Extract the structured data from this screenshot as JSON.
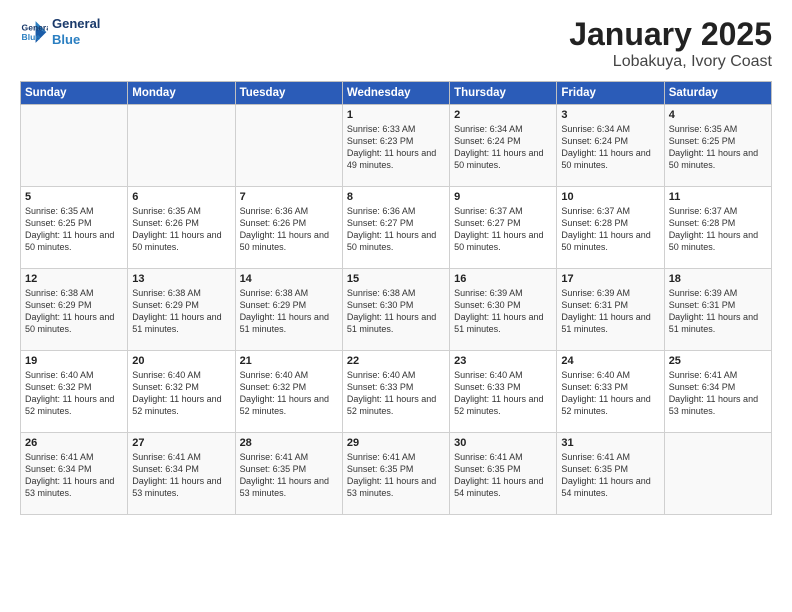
{
  "logo": {
    "line1": "General",
    "line2": "Blue"
  },
  "title": "January 2025",
  "subtitle": "Lobakuya, Ivory Coast",
  "days_of_week": [
    "Sunday",
    "Monday",
    "Tuesday",
    "Wednesday",
    "Thursday",
    "Friday",
    "Saturday"
  ],
  "weeks": [
    [
      {
        "day": "",
        "info": ""
      },
      {
        "day": "",
        "info": ""
      },
      {
        "day": "",
        "info": ""
      },
      {
        "day": "1",
        "info": "Sunrise: 6:33 AM\nSunset: 6:23 PM\nDaylight: 11 hours and 49 minutes."
      },
      {
        "day": "2",
        "info": "Sunrise: 6:34 AM\nSunset: 6:24 PM\nDaylight: 11 hours and 50 minutes."
      },
      {
        "day": "3",
        "info": "Sunrise: 6:34 AM\nSunset: 6:24 PM\nDaylight: 11 hours and 50 minutes."
      },
      {
        "day": "4",
        "info": "Sunrise: 6:35 AM\nSunset: 6:25 PM\nDaylight: 11 hours and 50 minutes."
      }
    ],
    [
      {
        "day": "5",
        "info": "Sunrise: 6:35 AM\nSunset: 6:25 PM\nDaylight: 11 hours and 50 minutes."
      },
      {
        "day": "6",
        "info": "Sunrise: 6:35 AM\nSunset: 6:26 PM\nDaylight: 11 hours and 50 minutes."
      },
      {
        "day": "7",
        "info": "Sunrise: 6:36 AM\nSunset: 6:26 PM\nDaylight: 11 hours and 50 minutes."
      },
      {
        "day": "8",
        "info": "Sunrise: 6:36 AM\nSunset: 6:27 PM\nDaylight: 11 hours and 50 minutes."
      },
      {
        "day": "9",
        "info": "Sunrise: 6:37 AM\nSunset: 6:27 PM\nDaylight: 11 hours and 50 minutes."
      },
      {
        "day": "10",
        "info": "Sunrise: 6:37 AM\nSunset: 6:28 PM\nDaylight: 11 hours and 50 minutes."
      },
      {
        "day": "11",
        "info": "Sunrise: 6:37 AM\nSunset: 6:28 PM\nDaylight: 11 hours and 50 minutes."
      }
    ],
    [
      {
        "day": "12",
        "info": "Sunrise: 6:38 AM\nSunset: 6:29 PM\nDaylight: 11 hours and 50 minutes."
      },
      {
        "day": "13",
        "info": "Sunrise: 6:38 AM\nSunset: 6:29 PM\nDaylight: 11 hours and 51 minutes."
      },
      {
        "day": "14",
        "info": "Sunrise: 6:38 AM\nSunset: 6:29 PM\nDaylight: 11 hours and 51 minutes."
      },
      {
        "day": "15",
        "info": "Sunrise: 6:38 AM\nSunset: 6:30 PM\nDaylight: 11 hours and 51 minutes."
      },
      {
        "day": "16",
        "info": "Sunrise: 6:39 AM\nSunset: 6:30 PM\nDaylight: 11 hours and 51 minutes."
      },
      {
        "day": "17",
        "info": "Sunrise: 6:39 AM\nSunset: 6:31 PM\nDaylight: 11 hours and 51 minutes."
      },
      {
        "day": "18",
        "info": "Sunrise: 6:39 AM\nSunset: 6:31 PM\nDaylight: 11 hours and 51 minutes."
      }
    ],
    [
      {
        "day": "19",
        "info": "Sunrise: 6:40 AM\nSunset: 6:32 PM\nDaylight: 11 hours and 52 minutes."
      },
      {
        "day": "20",
        "info": "Sunrise: 6:40 AM\nSunset: 6:32 PM\nDaylight: 11 hours and 52 minutes."
      },
      {
        "day": "21",
        "info": "Sunrise: 6:40 AM\nSunset: 6:32 PM\nDaylight: 11 hours and 52 minutes."
      },
      {
        "day": "22",
        "info": "Sunrise: 6:40 AM\nSunset: 6:33 PM\nDaylight: 11 hours and 52 minutes."
      },
      {
        "day": "23",
        "info": "Sunrise: 6:40 AM\nSunset: 6:33 PM\nDaylight: 11 hours and 52 minutes."
      },
      {
        "day": "24",
        "info": "Sunrise: 6:40 AM\nSunset: 6:33 PM\nDaylight: 11 hours and 52 minutes."
      },
      {
        "day": "25",
        "info": "Sunrise: 6:41 AM\nSunset: 6:34 PM\nDaylight: 11 hours and 53 minutes."
      }
    ],
    [
      {
        "day": "26",
        "info": "Sunrise: 6:41 AM\nSunset: 6:34 PM\nDaylight: 11 hours and 53 minutes."
      },
      {
        "day": "27",
        "info": "Sunrise: 6:41 AM\nSunset: 6:34 PM\nDaylight: 11 hours and 53 minutes."
      },
      {
        "day": "28",
        "info": "Sunrise: 6:41 AM\nSunset: 6:35 PM\nDaylight: 11 hours and 53 minutes."
      },
      {
        "day": "29",
        "info": "Sunrise: 6:41 AM\nSunset: 6:35 PM\nDaylight: 11 hours and 53 minutes."
      },
      {
        "day": "30",
        "info": "Sunrise: 6:41 AM\nSunset: 6:35 PM\nDaylight: 11 hours and 54 minutes."
      },
      {
        "day": "31",
        "info": "Sunrise: 6:41 AM\nSunset: 6:35 PM\nDaylight: 11 hours and 54 minutes."
      },
      {
        "day": "",
        "info": ""
      }
    ]
  ]
}
